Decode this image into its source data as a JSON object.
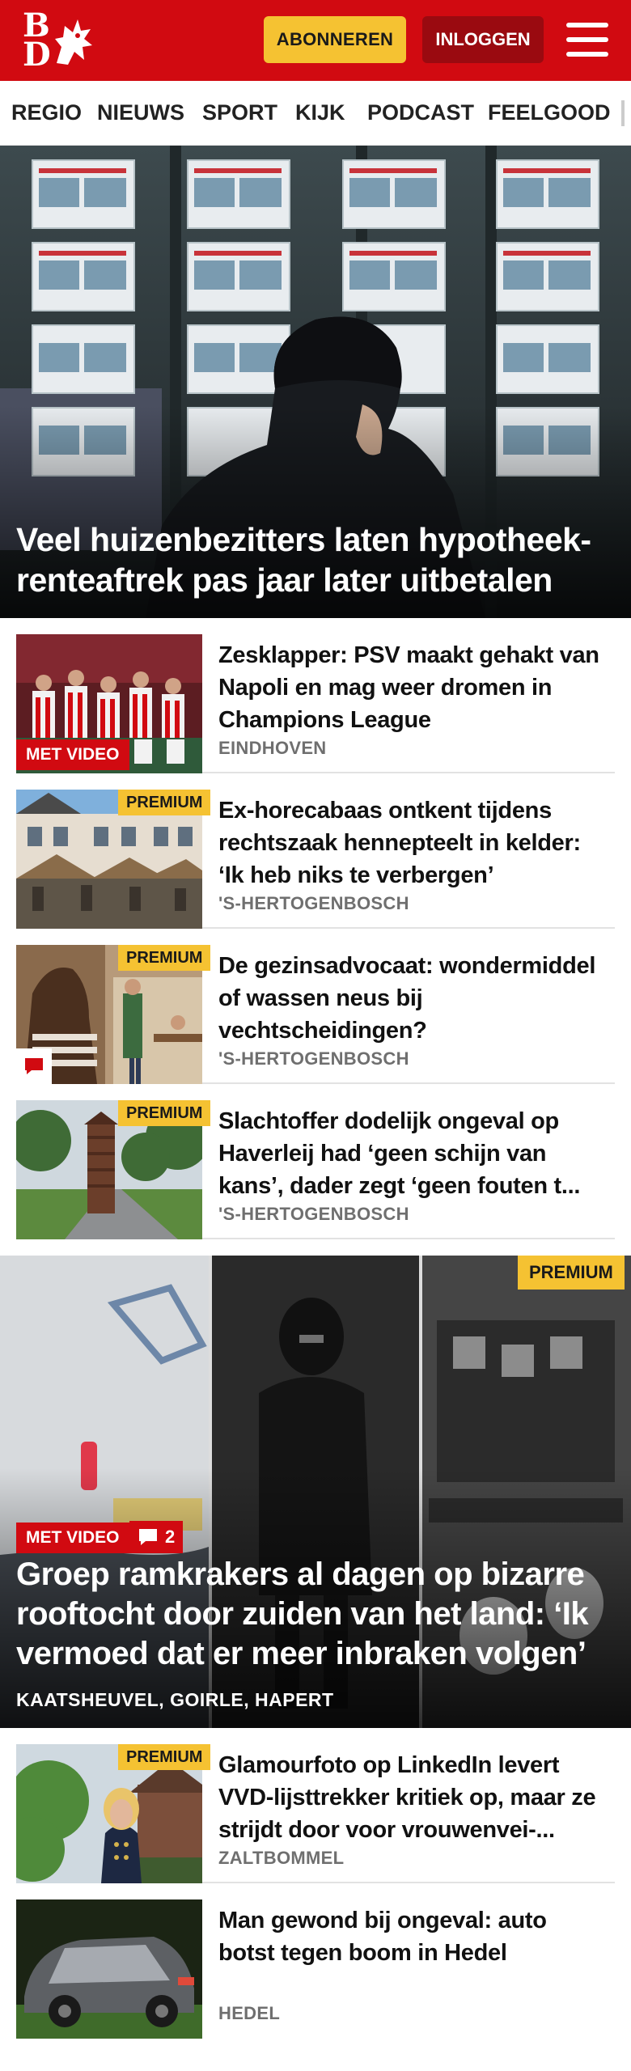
{
  "header": {
    "logo_text": "BD",
    "subscribe_label": "ABONNEREN",
    "login_label": "INLOGGEN",
    "brand_color": "#d10a11"
  },
  "nav": {
    "items": [
      "REGIO",
      "NIEUWS",
      "SPORT",
      "KIJK",
      "PODCAST",
      "FEELGOOD"
    ]
  },
  "hero": {
    "title": "Veel huizenbezitters laten hypotheek­renteaftrek pas jaar later uitbetalen"
  },
  "articles": [
    {
      "title": "Zesklapper: PSV maakt gehakt van Napoli en mag weer dromen in Champions League",
      "location": "EINDHOVEN",
      "badge": "MET VIDEO"
    },
    {
      "title": "Ex-horecabaas ontkent tijdens rechtszaak hennepteelt in kelder: ‘Ik heb niks te verbergen’",
      "location": "'S-HERTOGENBOSCH",
      "badge": "PREMIUM"
    },
    {
      "title": "De gezinsadvocaat: wondermid­del of wassen neus bij vechtscheidingen?",
      "location": "'S-HERTOGENBOSCH",
      "badge": "PREMIUM"
    },
    {
      "title": "Slachtoffer dodelijk ongeval op Haverleij had ‘geen schijn van kans’, dader zegt ‘geen fouten t...",
      "location": "'S-HERTOGENBOSCH",
      "badge": "PREMIUM"
    }
  ],
  "feature": {
    "title": "Groep ramkrakers al dagen op bizarre rooftocht door zuiden van het land: ‘Ik vermoed dat er meer inbraken volgen’",
    "location": "KAATSHEUVEL, GOIRLE, HAPERT",
    "video_badge": "MET VIDEO",
    "comment_count": "2",
    "premium_badge": "PREMIUM"
  },
  "articles2": [
    {
      "title": "Glamourfoto op LinkedIn levert VVD-lijsttrekker kritiek op, maar ze strijdt door voor vrouwenvei-...",
      "location": "ZALTBOMMEL",
      "badge": "PREMIUM"
    },
    {
      "title": "Man gewond bij ongeval: auto botst tegen boom in Hedel",
      "location": "HEDEL"
    }
  ]
}
